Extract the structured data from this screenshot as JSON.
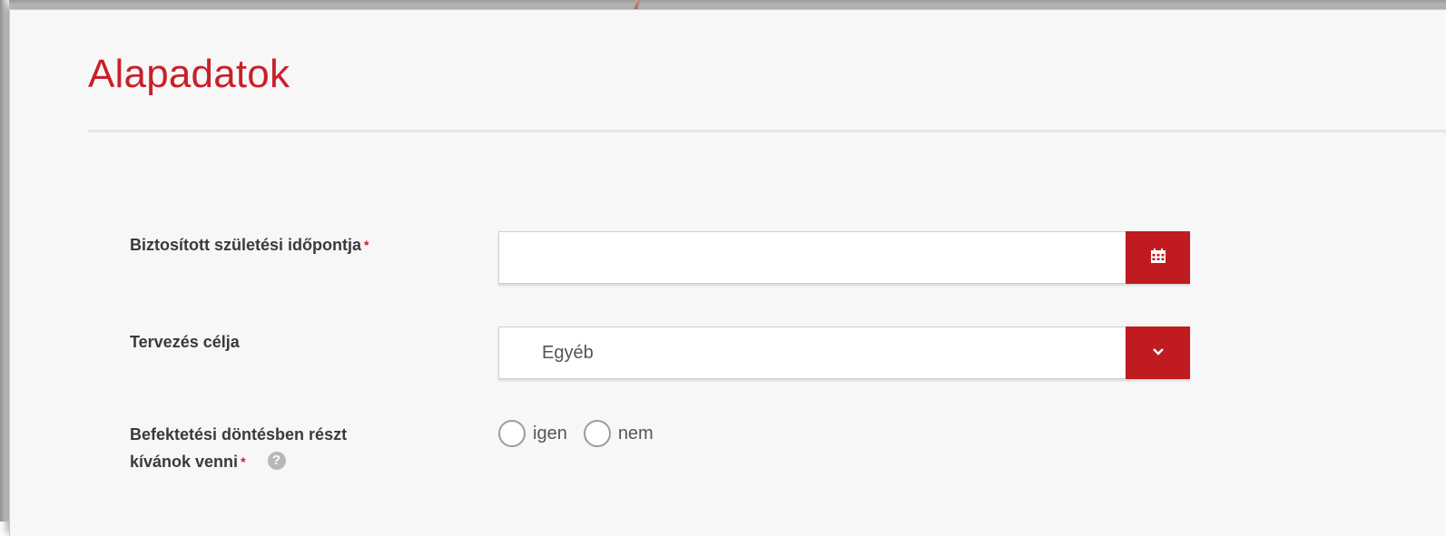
{
  "section": {
    "title": "Alapadatok"
  },
  "fields": {
    "birthdate": {
      "label": "Biztosított születési időpontja",
      "required_mark": "*",
      "value": "",
      "button_icon": "calendar-icon"
    },
    "purpose": {
      "label": "Tervezés célja",
      "selected": "Egyéb",
      "button_icon": "chevron-down-icon"
    },
    "investment_decision": {
      "label_line1": "Befektetési döntésben részt",
      "label_line2": "kívánok venni",
      "required_mark": "*",
      "help_icon": "question-icon",
      "help_glyph": "?",
      "options": [
        "igen",
        "nem"
      ]
    }
  },
  "colors": {
    "accent": "#c01b20",
    "title": "#c8202a",
    "background": "#f7f7f7"
  }
}
